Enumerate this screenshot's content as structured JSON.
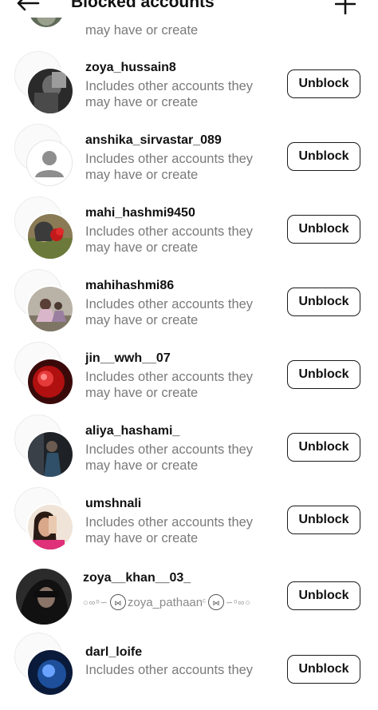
{
  "header": {
    "title": "Blocked accounts",
    "back_icon": "arrow-left-icon",
    "add_icon": "plus-icon"
  },
  "partial_top": {
    "subtext_line2": "may have or create"
  },
  "accounts": [
    {
      "username": "zoya_hussain8",
      "line1": "Includes other accounts they",
      "line2": "may have or create",
      "button": "Unblock"
    },
    {
      "username": "anshika_sirvastar_089",
      "line1": "Includes other accounts they",
      "line2": "may have or create",
      "button": "Unblock"
    },
    {
      "username": "mahi_hashmi9450",
      "line1": "Includes other accounts they",
      "line2": "may have or create",
      "button": "Unblock"
    },
    {
      "username": "mahihashmi86",
      "line1": "Includes other accounts they",
      "line2": "may have or create",
      "button": "Unblock"
    },
    {
      "username": "jin__wwh__07",
      "line1": "Includes other accounts they",
      "line2": "may have or create",
      "button": "Unblock"
    },
    {
      "username": "aliya_hashami_",
      "line1": "Includes other accounts they",
      "line2": "may have or create",
      "button": "Unblock"
    },
    {
      "username": "umshnali",
      "line1": "Includes other accounts they",
      "line2": "may have or create",
      "button": "Unblock"
    },
    {
      "username": "zoya__khan__03_",
      "deco_text": "zoya_pathaan",
      "button": "Unblock"
    },
    {
      "username": "darl_loife",
      "line1": "Includes other accounts they",
      "line2": "",
      "button": "Unblock"
    }
  ],
  "colors": {
    "text_primary": "#111111",
    "text_secondary": "#7a7a7a",
    "button_border": "#1a1a1a",
    "background": "#ffffff"
  }
}
